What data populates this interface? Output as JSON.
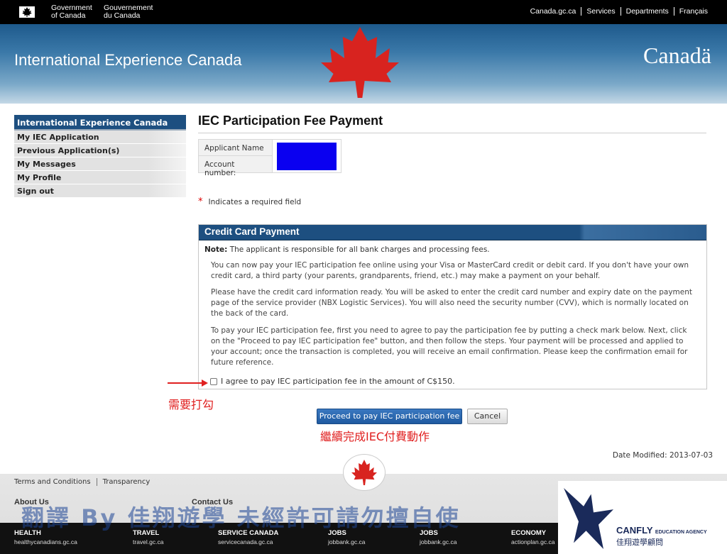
{
  "topbar": {
    "govt_en_1": "Government",
    "govt_en_2": "of Canada",
    "govt_fr_1": "Gouvernement",
    "govt_fr_2": "du Canada",
    "links": [
      "Canada.gc.ca",
      "Services",
      "Departments",
      "Français"
    ]
  },
  "banner": {
    "title": "International Experience Canada",
    "wordmark": "Canadä"
  },
  "sidebar": {
    "heading": "International Experience Canada",
    "items": [
      {
        "label": "My IEC Application"
      },
      {
        "label": "Previous Application(s)"
      },
      {
        "label": "My Messages"
      },
      {
        "label": "My Profile"
      },
      {
        "label": "Sign out"
      }
    ]
  },
  "main": {
    "title": "IEC Participation Fee Payment",
    "applicant_name_label": "Applicant Name",
    "account_number_label": "Account number:",
    "required_star": "*",
    "required_text": "Indicates a required field"
  },
  "credit_card": {
    "heading": "Credit Card Payment",
    "note_label": "Note:",
    "note_text": "The applicant is responsible for all bank charges and processing fees.",
    "para1": "You can now pay your IEC participation fee online using your Visa or MasterCard credit or debit card. If you don't have your own credit card, a third party (your parents, grandparents, friend, etc.) may make a payment on your behalf.",
    "para2": "Please have the credit card information ready. You will be asked to enter the credit card number and expiry date on the payment page of the service provider (NBX Logistic Services). You will also need the security number (CVV), which is normally located on the back of the card.",
    "para3": "To pay your IEC participation fee, first you need to agree to pay the participation fee by putting a check mark below. Next, click on the \"Proceed to pay IEC participation fee\" button, and then follow the steps. Your payment will be processed and applied to your account; once the transaction is completed, you will receive an email confirmation. Please keep the confirmation email for future reference.",
    "agree_label": "I agree to pay IEC participation fee in the amount of C$150."
  },
  "annotations": {
    "check_note": "需要打勾",
    "continue_note": "繼續完成IEC付費動作"
  },
  "buttons": {
    "proceed": "Proceed to pay IEC participation fee",
    "cancel": "Cancel"
  },
  "date_modified": "Date Modified: 2013-07-03",
  "footer": {
    "terms": "Terms and Conditions",
    "transparency": "Transparency",
    "about": "About Us",
    "contact": "Contact Us",
    "watermark": "翻譯 By 佳翔遊學 未經許可請勿擅自使",
    "columns": [
      {
        "heading": "HEALTH",
        "url": "healthycanadians.gc.ca"
      },
      {
        "heading": "TRAVEL",
        "url": "travel.gc.ca"
      },
      {
        "heading": "SERVICE CANADA",
        "url": "servicecanada.gc.ca"
      },
      {
        "heading": "JOBS",
        "url": "jobbank.gc.ca"
      },
      {
        "heading": "JOBS",
        "url": "jobbank.gc.ca"
      },
      {
        "heading": "ECONOMY",
        "url": "actionplan.gc.ca"
      }
    ]
  },
  "logo": {
    "name": "CANFLY",
    "tagline": "EDUCATION AGENCY",
    "chinese": "佳翔遊學顧問"
  },
  "colors": {
    "header_blue": "#1d4f80",
    "canada_red": "#d8231f",
    "annotation_red": "#e02020",
    "button_blue": "#2a66ae"
  }
}
